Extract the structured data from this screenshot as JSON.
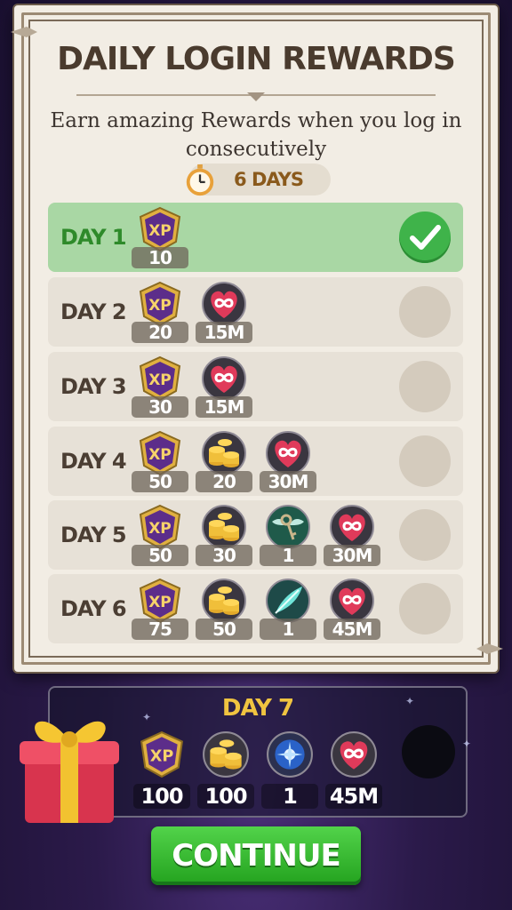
{
  "header": {
    "title": "DAILY LOGIN REWARDS",
    "subtitle": "Earn amazing Rewards when you log in consecutively",
    "streak_label": "6 DAYS"
  },
  "days": [
    {
      "label": "DAY 1",
      "claimed": true,
      "rewards": [
        {
          "icon": "xp-badge-icon",
          "amount": "10"
        }
      ]
    },
    {
      "label": "DAY 2",
      "claimed": false,
      "rewards": [
        {
          "icon": "xp-badge-icon",
          "amount": "20"
        },
        {
          "icon": "infinity-heart-icon",
          "amount": "15M"
        }
      ]
    },
    {
      "label": "DAY 3",
      "claimed": false,
      "rewards": [
        {
          "icon": "xp-badge-icon",
          "amount": "30"
        },
        {
          "icon": "infinity-heart-icon",
          "amount": "15M"
        }
      ]
    },
    {
      "label": "DAY 4",
      "claimed": false,
      "rewards": [
        {
          "icon": "xp-badge-icon",
          "amount": "50"
        },
        {
          "icon": "gold-coins-icon",
          "amount": "20"
        },
        {
          "icon": "infinity-heart-icon",
          "amount": "30M"
        }
      ]
    },
    {
      "label": "DAY 5",
      "claimed": false,
      "rewards": [
        {
          "icon": "xp-badge-icon",
          "amount": "50"
        },
        {
          "icon": "gold-coins-icon",
          "amount": "30"
        },
        {
          "icon": "winged-key-icon",
          "amount": "1"
        },
        {
          "icon": "infinity-heart-icon",
          "amount": "30M"
        }
      ]
    },
    {
      "label": "DAY 6",
      "claimed": false,
      "rewards": [
        {
          "icon": "xp-badge-icon",
          "amount": "75"
        },
        {
          "icon": "gold-coins-icon",
          "amount": "50"
        },
        {
          "icon": "feather-icon",
          "amount": "1"
        },
        {
          "icon": "infinity-heart-icon",
          "amount": "45M"
        }
      ]
    }
  ],
  "day7": {
    "label": "DAY 7",
    "claimed": false,
    "rewards": [
      {
        "icon": "xp-badge-icon",
        "amount": "100"
      },
      {
        "icon": "gold-coins-icon",
        "amount": "100"
      },
      {
        "icon": "blue-orb-icon",
        "amount": "1"
      },
      {
        "icon": "infinity-heart-icon",
        "amount": "45M"
      }
    ]
  },
  "continue_label": "CONTINUE",
  "colors": {
    "claimed_row": "#a9d7a4",
    "claimed_text": "#2e8a2a",
    "day7_title": "#f0c440",
    "continue_button": "#3cc234"
  }
}
